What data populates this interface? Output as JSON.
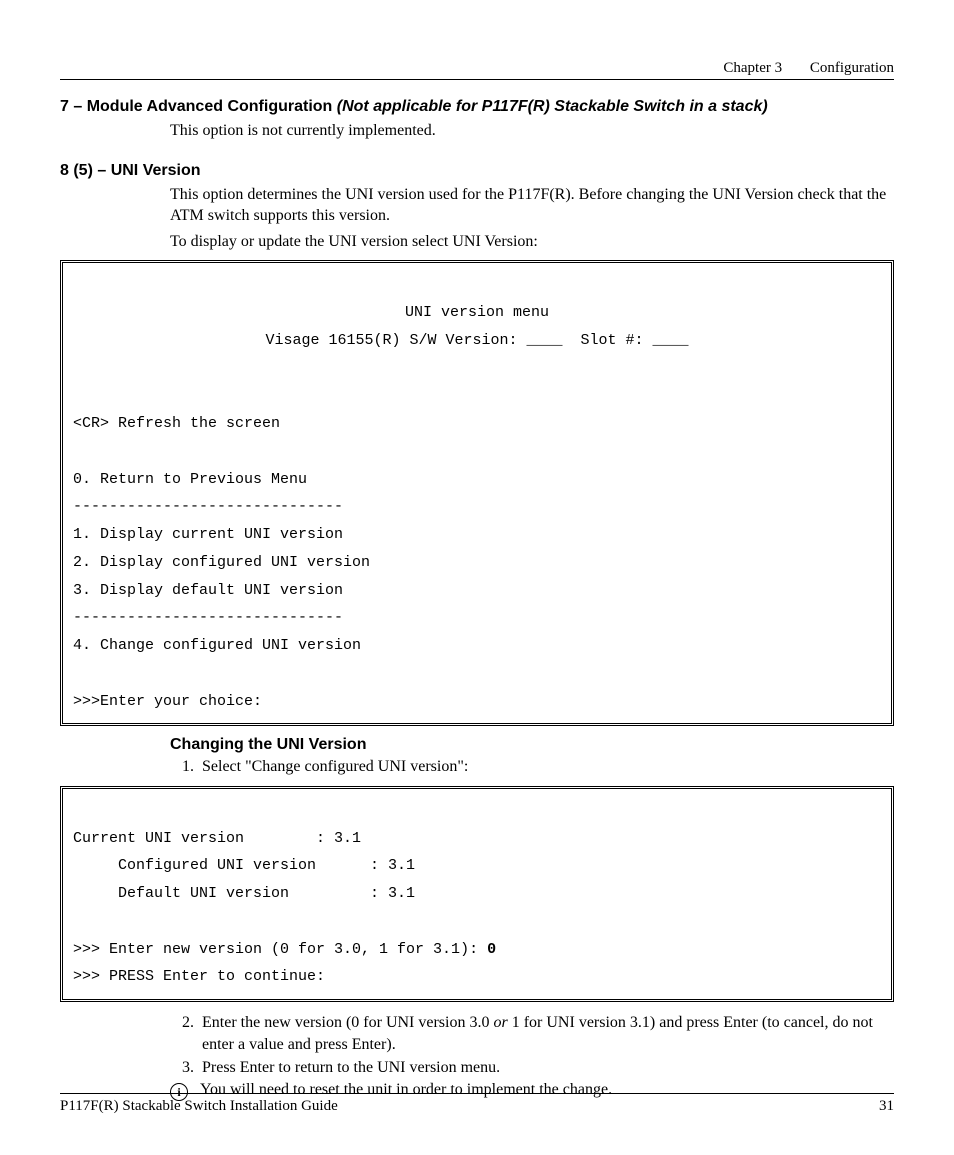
{
  "header": {
    "chapter": "Chapter 3",
    "title": "Configuration"
  },
  "sec7": {
    "heading_prefix": "7 – Module Advanced Configuration  ",
    "heading_italic": "(Not applicable for P117F(R) Stackable Switch in a stack)",
    "body": "This option is not currently implemented."
  },
  "sec8": {
    "heading": "8 (5) – UNI Version",
    "p1": "This option determines the UNI version used for the P117F(R). Before changing the UNI Version check that the ATM switch supports this version.",
    "p2": "To display or update the UNI version select UNI Version:"
  },
  "term1": {
    "l1": "UNI version menu",
    "l2": "Visage 16155(R) S/W Version: ____  Slot #: ____",
    "blank": "",
    "l3": "<CR> Refresh the screen",
    "l4": "0. Return to Previous Menu",
    "l5": "------------------------------",
    "l6": "1. Display current UNI version",
    "l7": "2. Display configured UNI version",
    "l8": "3. Display default UNI version",
    "l9": "------------------------------",
    "l10": "4. Change configured UNI version",
    "l11": ">>>Enter your choice:"
  },
  "changing": {
    "heading": "Changing the UNI Version",
    "step1": "Select \"Change configured UNI version\":",
    "step2a": "Enter the new version (0 for UNI version 3.0 ",
    "step2or": "or",
    "step2b": " 1 for UNI version 3.1) and press Enter (to cancel, do not enter a value and press Enter).",
    "step3": "Press Enter to return to the UNI version menu.",
    "note_icon": "i",
    "note": "You will need to reset the unit in order to implement the change."
  },
  "term2": {
    "l1": "Current UNI version        : 3.1",
    "l2": "     Configured UNI version      : 3.1",
    "l3": "     Default UNI version         : 3.1",
    "blank": "",
    "l4a": ">>> Enter new version (0 for 3.0, 1 for 3.1): ",
    "l4b": "0",
    "l5": ">>> PRESS Enter to continue:"
  },
  "footer": {
    "left": "P117F(R) Stackable Switch Installation Guide",
    "right": "31"
  }
}
